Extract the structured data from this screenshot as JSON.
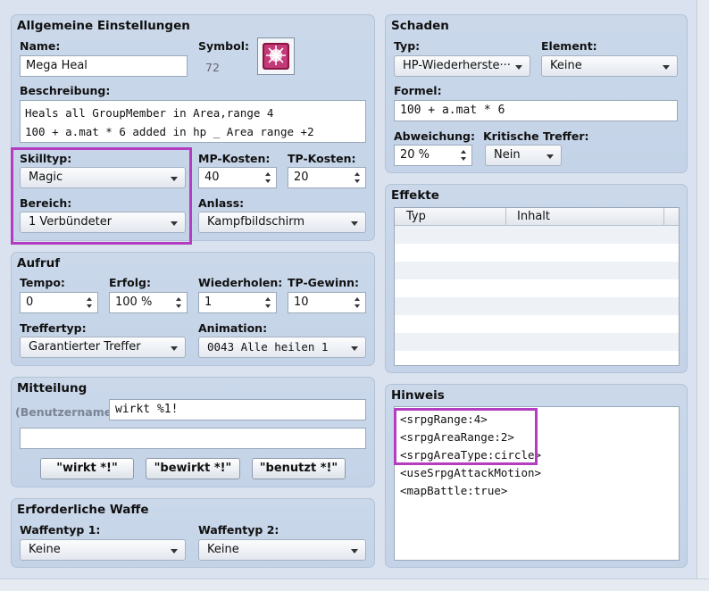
{
  "general": {
    "title": "Allgemeine Einstellungen",
    "name_label": "Name:",
    "name_value": "Mega Heal",
    "symbol_label": "Symbol:",
    "symbol_index": "72",
    "icon": "heal-skill-icon",
    "description_label": "Beschreibung:",
    "description_line1": "Heals all GroupMember in Area,range 4",
    "description_line2": "100 + a.mat * 6 added in hp _ Area range +2",
    "skilltype_label": "Skilltyp:",
    "skilltype_value": "Magic",
    "mpcost_label": "MP-Kosten:",
    "mpcost_value": "40",
    "tpcost_label": "TP-Kosten:",
    "tpcost_value": "20",
    "scope_label": "Bereich:",
    "scope_value": "1 Verbündeter",
    "occasion_label": "Anlass:",
    "occasion_value": "Kampfbildschirm"
  },
  "invocation": {
    "title": "Aufruf",
    "speed_label": "Tempo:",
    "speed_value": "0",
    "success_label": "Erfolg:",
    "success_value": "100 %",
    "repeat_label": "Wiederholen:",
    "repeat_value": "1",
    "tpgain_label": "TP-Gewinn:",
    "tpgain_value": "10",
    "hittype_label": "Treffertyp:",
    "hittype_value": "Garantierter Treffer",
    "animation_label": "Animation:",
    "animation_value": "0043 Alle heilen 1"
  },
  "message": {
    "title": "Mitteilung",
    "user_placeholder": "(Benutzername)",
    "line1": "wirkt %1!",
    "line2": "",
    "btn_casts": "\"wirkt *!\"",
    "btn_does": "\"bewirkt *!\"",
    "btn_uses": "\"benutzt *!\""
  },
  "weapon": {
    "title": "Erforderliche Waffe",
    "type1_label": "Waffentyp 1:",
    "type1_value": "Keine",
    "type2_label": "Waffentyp 2:",
    "type2_value": "Keine"
  },
  "damage": {
    "title": "Schaden",
    "type_label": "Typ:",
    "type_value": "HP-Wiederherste···",
    "element_label": "Element:",
    "element_value": "Keine",
    "formula_label": "Formel:",
    "formula_value": "100 + a.mat * 6",
    "variance_label": "Abweichung:",
    "variance_value": "20 %",
    "critical_label": "Kritische Treffer:",
    "critical_value": "Nein"
  },
  "effects": {
    "title": "Effekte",
    "col_type": "Typ",
    "col_content": "Inhalt"
  },
  "note": {
    "title": "Hinweis",
    "lines": [
      "<srpgRange:4>",
      "<srpgAreaRange:2>",
      "<srpgAreaType:circle>",
      "<useSrpgAttackMotion>",
      "<mapBattle:true>"
    ]
  },
  "colors": {
    "highlight": "#b33cc0",
    "panel": "#c8d6e8",
    "background": "#d9e2ee"
  }
}
